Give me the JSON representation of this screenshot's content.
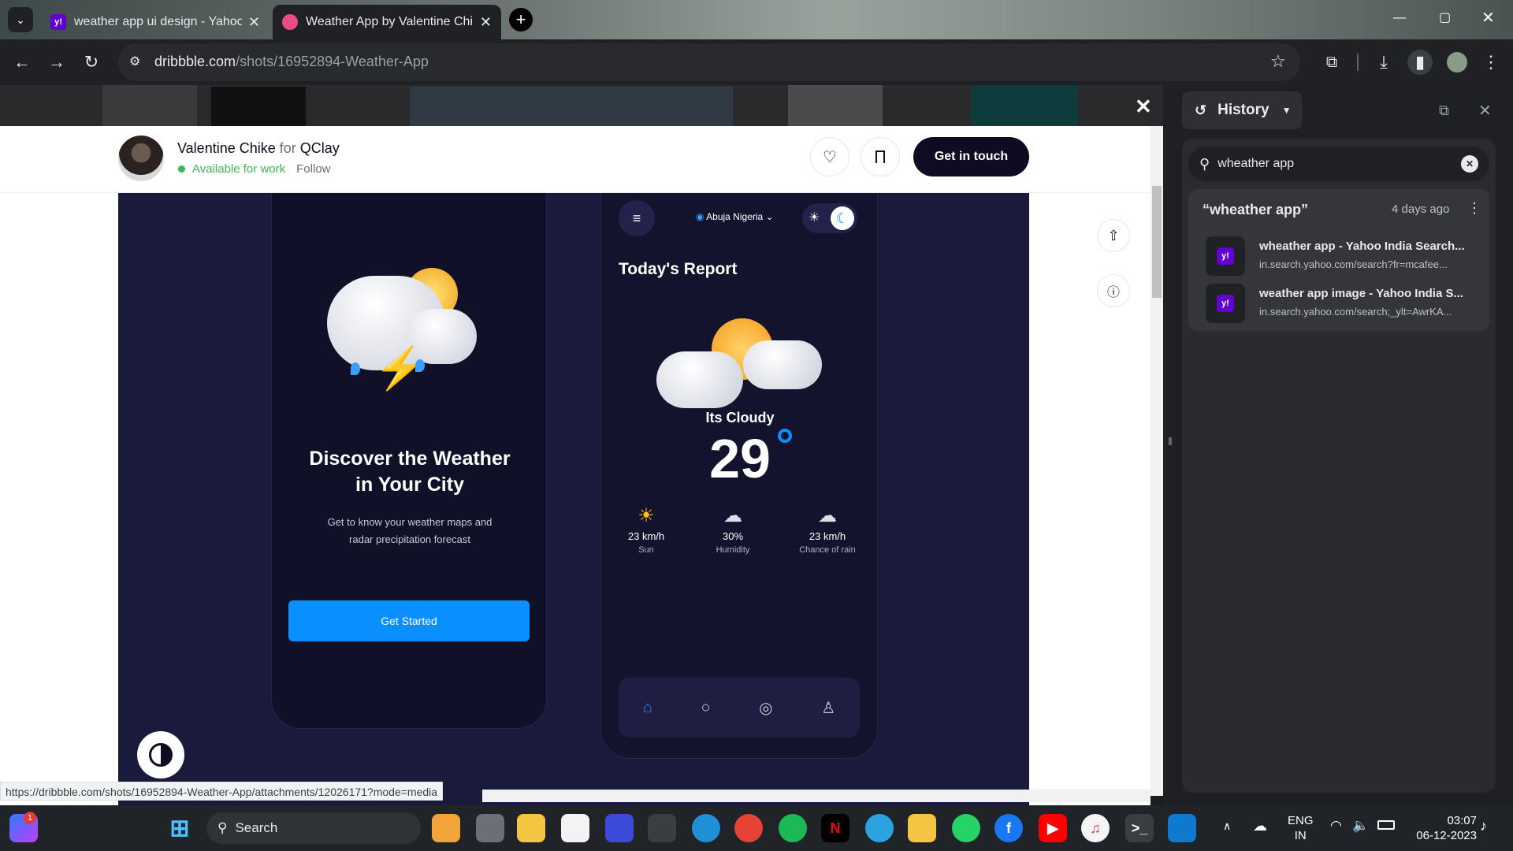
{
  "browser": {
    "tabs": [
      {
        "title": "weather app ui design - Yahoo",
        "favicon": "y!"
      },
      {
        "title": "Weather App by Valentine Chik",
        "favicon": "dribbble-icon"
      }
    ],
    "url_domain": "dribbble.com",
    "url_path": "/shots/16952894-Weather-App",
    "status_url": "https://dribbble.com/shots/16952894-Weather-App/attachments/12026171?mode=media"
  },
  "shot": {
    "author": "Valentine Chike",
    "for_label": "for",
    "team": "QClay",
    "availability": "Available for work",
    "follow": "Follow",
    "cta": "Get in touch"
  },
  "phone_left": {
    "title_line1": "Discover the Weather",
    "title_line2": "in Your City",
    "subtitle_line1": "Get to know your weather maps and",
    "subtitle_line2": "radar precipitation forecast",
    "button": "Get Started"
  },
  "phone_right": {
    "location": "Abuja Nigeria",
    "heading": "Today's Report",
    "condition": "Its Cloudy",
    "temperature": "29",
    "stats": [
      {
        "value": "23 km/h",
        "label": "Sun"
      },
      {
        "value": "30%",
        "label": "Humidity"
      },
      {
        "value": "23 km/h",
        "label": "Chance of rain"
      }
    ]
  },
  "history": {
    "title": "History",
    "search_value": "wheather app",
    "group_title": "“wheather app”",
    "group_time": "4 days ago",
    "items": [
      {
        "title": "wheather app - Yahoo India Search...",
        "url": "in.search.yahoo.com/search?fr=mcafee..."
      },
      {
        "title": "weather app image - Yahoo India S...",
        "url": "in.search.yahoo.com/search;_ylt=AwrKA..."
      }
    ]
  },
  "taskbar": {
    "search_label": "Search",
    "lang_top": "ENG",
    "lang_bottom": "IN",
    "time": "03:07",
    "date": "06-12-2023",
    "notification_count": "1"
  },
  "colors": {
    "accent_blue": "#0a84ff",
    "dark_navy": "#1b1b3a",
    "card_navy": "#12122a"
  }
}
